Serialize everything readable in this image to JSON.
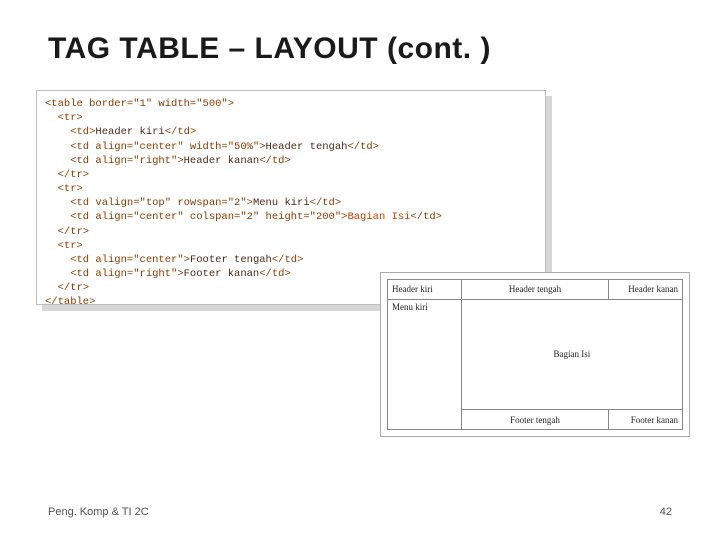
{
  "title": "TAG TABLE – LAYOUT (cont. )",
  "code": {
    "l1a": "<table border=\"1\" width=\"500\">",
    "l2": "  <tr>",
    "l3a": "    <td>",
    "l3b": "Header kiri",
    "l3c": "</td>",
    "l4a": "    <td align=\"center\" width=\"50%\">",
    "l4b": "Header tengah",
    "l4c": "</td>",
    "l5a": "    <td align=\"right\">",
    "l5b": "Header kanan",
    "l5c": "</td>",
    "l6": "  </tr>",
    "l7": "  <tr>",
    "l8a": "    <td valign=\"top\" rowspan=\"2\">",
    "l8b": "Menu kiri",
    "l8c": "</td>",
    "l9a": "    <td align=\"center\" colspan=\"2\" height=\"200\">",
    "l9b": "Bagian Isi",
    "l9c": "</td>",
    "l10": "  </tr>",
    "l11": "  <tr>",
    "l12a": "    <td align=\"center\">",
    "l12b": "Footer tengah",
    "l12c": "</td>",
    "l13a": "    <td align=\"right\">",
    "l13b": "Footer kanan",
    "l13c": "</td>",
    "l14": "  </tr>",
    "l15": "</table>"
  },
  "render": {
    "header_kiri": "Header kiri",
    "header_tengah": "Header tengah",
    "header_kanan": "Header kanan",
    "menu_kiri": "Menu kiri",
    "bagian_isi": "Bagian Isi",
    "footer_tengah": "Footer tengah",
    "footer_kanan": "Footer kanan"
  },
  "footer": {
    "left": "Peng. Komp & TI 2C",
    "page": "42"
  }
}
